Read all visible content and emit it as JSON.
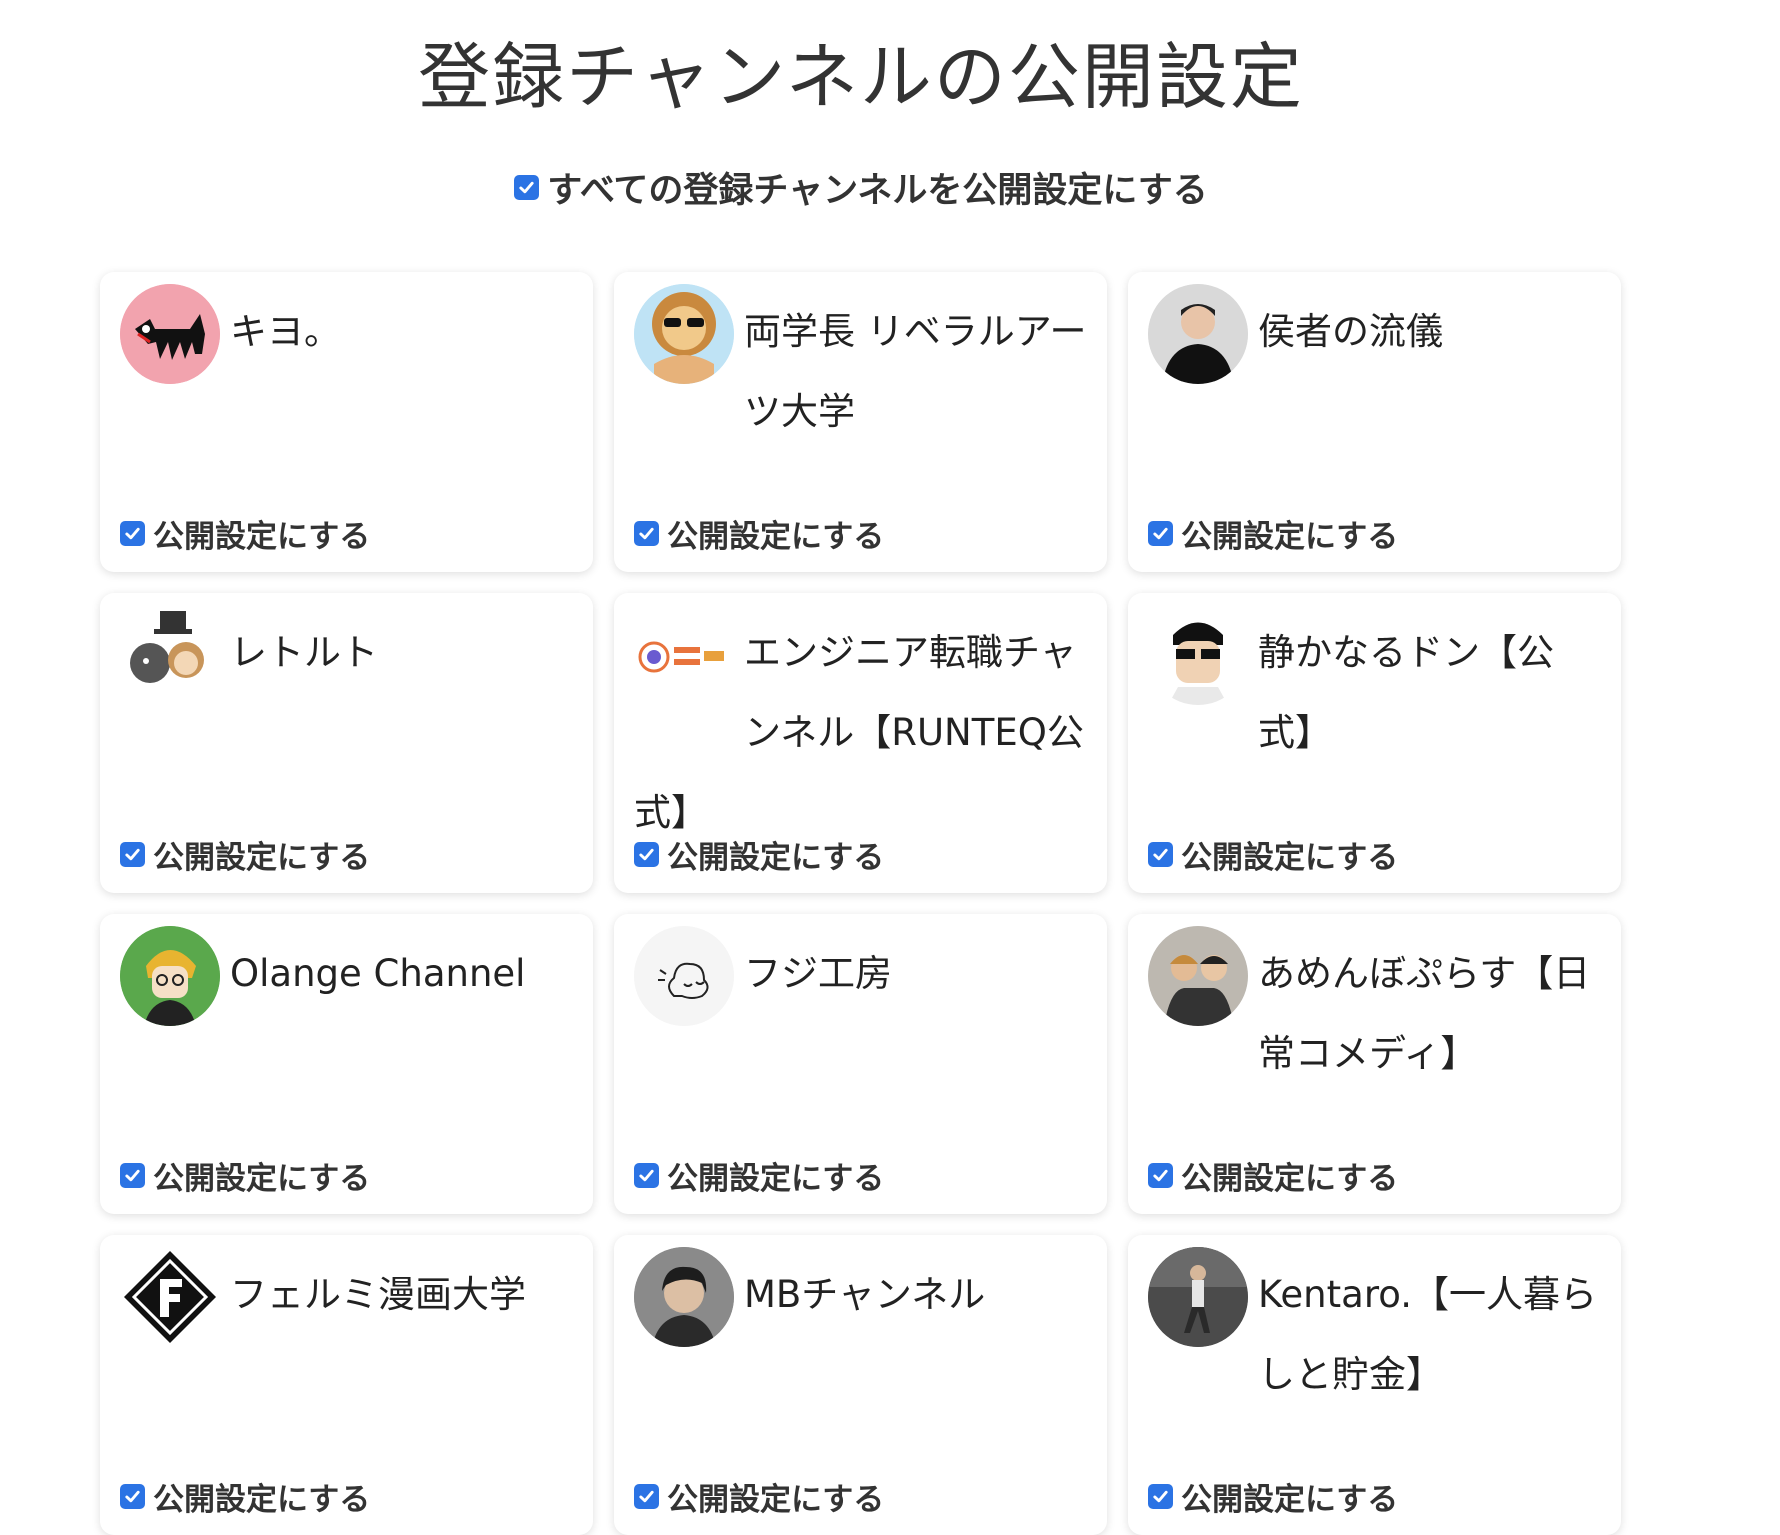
{
  "title": "登録チャンネルの公開設定",
  "select_all": {
    "label": "すべての登録チャンネルを公開設定にする",
    "checked": true
  },
  "channels": [
    {
      "name": "キヨ。",
      "avatar": "cat-avatar-icon",
      "public_label": "公開設定にする",
      "checked": true
    },
    {
      "name": "両学長 リベラルアーツ大学",
      "avatar": "lion-avatar-icon",
      "public_label": "公開設定にする",
      "checked": true
    },
    {
      "name": "侯者の流儀",
      "avatar": "person-avatar-icon",
      "public_label": "公開設定にする",
      "checked": true
    },
    {
      "name": "レトルト",
      "avatar": "characters-avatar-icon",
      "public_label": "公開設定にする",
      "checked": true
    },
    {
      "name": "エンジニア転職チャンネル【RUNTEQ公式】",
      "avatar": "runteq-avatar-icon",
      "public_label": "公開設定にする",
      "checked": true
    },
    {
      "name": "静かなるドン【公式】",
      "avatar": "manga-face-avatar-icon",
      "public_label": "公開設定にする",
      "checked": true
    },
    {
      "name": "Olange Channel",
      "avatar": "anime-avatar-icon",
      "public_label": "公開設定にする",
      "checked": true
    },
    {
      "name": "フジ工房",
      "avatar": "sketch-avatar-icon",
      "public_label": "公開設定にする",
      "checked": true
    },
    {
      "name": "あめんぼぷらす【日常コメディ】",
      "avatar": "duo-avatar-icon",
      "public_label": "公開設定にする",
      "checked": true
    },
    {
      "name": "フェルミ漫画大学",
      "avatar": "f-logo-avatar-icon",
      "public_label": "公開設定にする",
      "checked": true
    },
    {
      "name": "MBチャンネル",
      "avatar": "portrait-avatar-icon",
      "public_label": "公開設定にする",
      "checked": true
    },
    {
      "name": "Kentaro.【一人暮らしと貯金】",
      "avatar": "street-avatar-icon",
      "public_label": "公開設定にする",
      "checked": true
    }
  ],
  "colors": {
    "checkbox": "#2b73e4",
    "card_bg": "#ffffff"
  }
}
